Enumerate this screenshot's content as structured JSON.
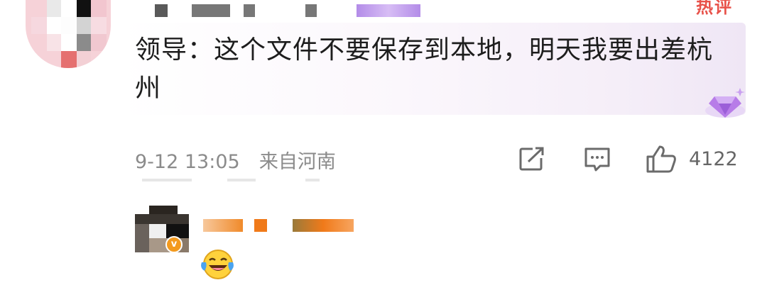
{
  "comment": {
    "text": "领导：这个文件不要保存到本地，明天我要出差杭州",
    "hot_label": "热评",
    "timestamp": "9-12 13:05",
    "location": "来自河南",
    "like_count": "4122"
  },
  "reply": {
    "emoji": "laughing-crying-emoji"
  },
  "colors": {
    "accent": "#e8524a",
    "badge": "#f39a1e",
    "gem": "#b77ce8",
    "meta_text": "#8b8b8b"
  },
  "icons": [
    "share-icon",
    "comment-icon",
    "like-icon",
    "gem-badge-icon",
    "verified-badge-icon"
  ]
}
